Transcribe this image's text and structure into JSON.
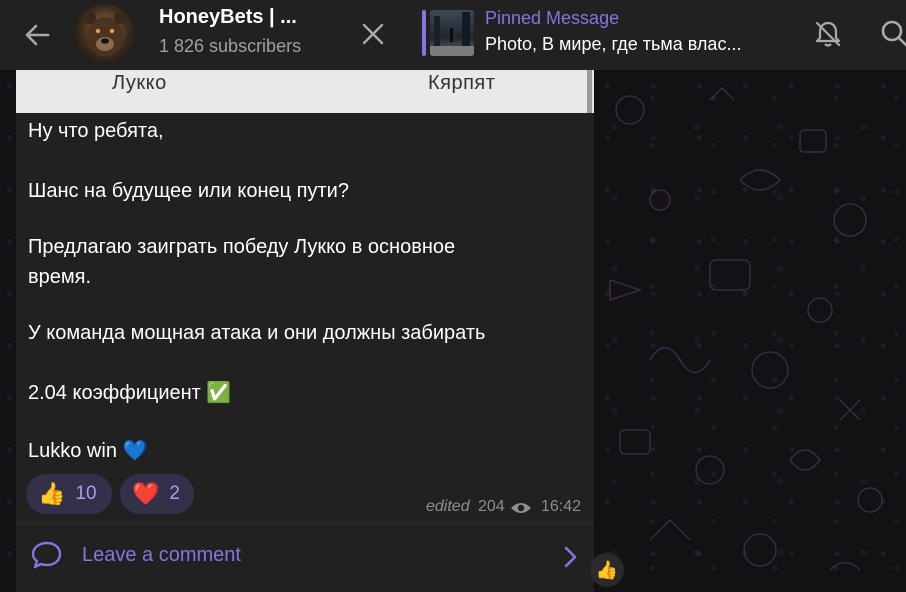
{
  "header": {
    "channel_title": "HoneyBets | ...",
    "subscribers": "1 826 subscribers",
    "pinned_label": "Pinned Message",
    "pinned_text": "Photo, В мире, где тьма влас..."
  },
  "message": {
    "photo_caption_left": "Лукко",
    "photo_caption_right": "Кярпят",
    "lines": [
      "Ну что ребята,",
      "Шанс на будущее или конец пути?",
      "Предлагаю заиграть победу Лукко в основное",
      "время.",
      "У команда мощная атака и они должны забирать",
      "2.04 коэффициент ✅",
      "Lukko win 💙"
    ],
    "reactions": [
      {
        "emoji": "👍",
        "count": "10"
      },
      {
        "emoji": "❤️",
        "count": "2"
      }
    ],
    "edited_label": "edited",
    "views": "204",
    "time": "16:42",
    "comment_label": "Leave a comment"
  },
  "side_reaction": {
    "emoji": "👍"
  },
  "colors": {
    "accent": "#8774e1",
    "bubble": "#212121",
    "header": "#212121"
  }
}
